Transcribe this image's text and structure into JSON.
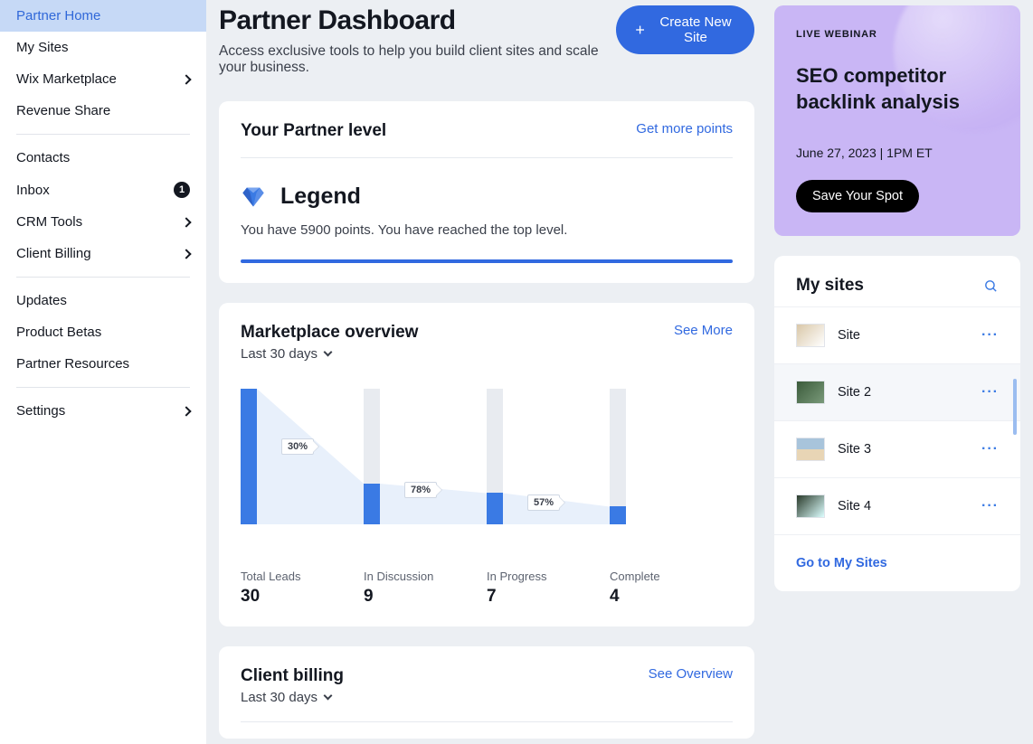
{
  "sidebar": {
    "items": [
      {
        "label": "Partner Home",
        "active": true
      },
      {
        "label": "My Sites"
      },
      {
        "label": "Wix Marketplace",
        "chevron": true
      },
      {
        "label": "Revenue Share"
      }
    ],
    "items2": [
      {
        "label": "Contacts"
      },
      {
        "label": "Inbox",
        "badge": "1"
      },
      {
        "label": "CRM Tools",
        "chevron": true
      },
      {
        "label": "Client Billing",
        "chevron": true
      }
    ],
    "items3": [
      {
        "label": "Updates"
      },
      {
        "label": "Product Betas"
      },
      {
        "label": "Partner Resources"
      }
    ],
    "items4": [
      {
        "label": "Settings",
        "chevron": true
      }
    ]
  },
  "header": {
    "title": "Partner Dashboard",
    "subtitle": "Access exclusive tools to help you build client sites and scale your business.",
    "create_button": "Create New Site"
  },
  "partner_level": {
    "title": "Your Partner level",
    "points_link": "Get more points",
    "level_name": "Legend",
    "description": "You have 5900 points. You have reached the top level."
  },
  "marketplace": {
    "title": "Marketplace overview",
    "period": "Last 30 days",
    "see_more": "See More",
    "stages": [
      {
        "label": "Total Leads",
        "value": "30",
        "pct": "30%"
      },
      {
        "label": "In Discussion",
        "value": "9",
        "pct": "78%"
      },
      {
        "label": "In Progress",
        "value": "7",
        "pct": "57%"
      },
      {
        "label": "Complete",
        "value": "4"
      }
    ]
  },
  "client_billing": {
    "title": "Client billing",
    "period": "Last 30 days",
    "see_overview": "See Overview"
  },
  "webinar": {
    "eyebrow": "LIVE WEBINAR",
    "title": "SEO competitor backlink analysis",
    "date": "June 27, 2023 | 1PM ET",
    "cta": "Save Your Spot"
  },
  "my_sites": {
    "title": "My sites",
    "rows": [
      {
        "name": "Site"
      },
      {
        "name": "Site 2"
      },
      {
        "name": "Site 3"
      },
      {
        "name": "Site 4"
      }
    ],
    "footer_link": "Go to My Sites"
  },
  "chart_data": {
    "type": "bar",
    "title": "Marketplace overview — Last 30 days",
    "categories": [
      "Total Leads",
      "In Discussion",
      "In Progress",
      "Complete"
    ],
    "values": [
      30,
      9,
      7,
      4
    ],
    "conversion_pct": [
      30,
      78,
      57
    ],
    "ylim": [
      0,
      30
    ],
    "xlabel": "",
    "ylabel": ""
  }
}
